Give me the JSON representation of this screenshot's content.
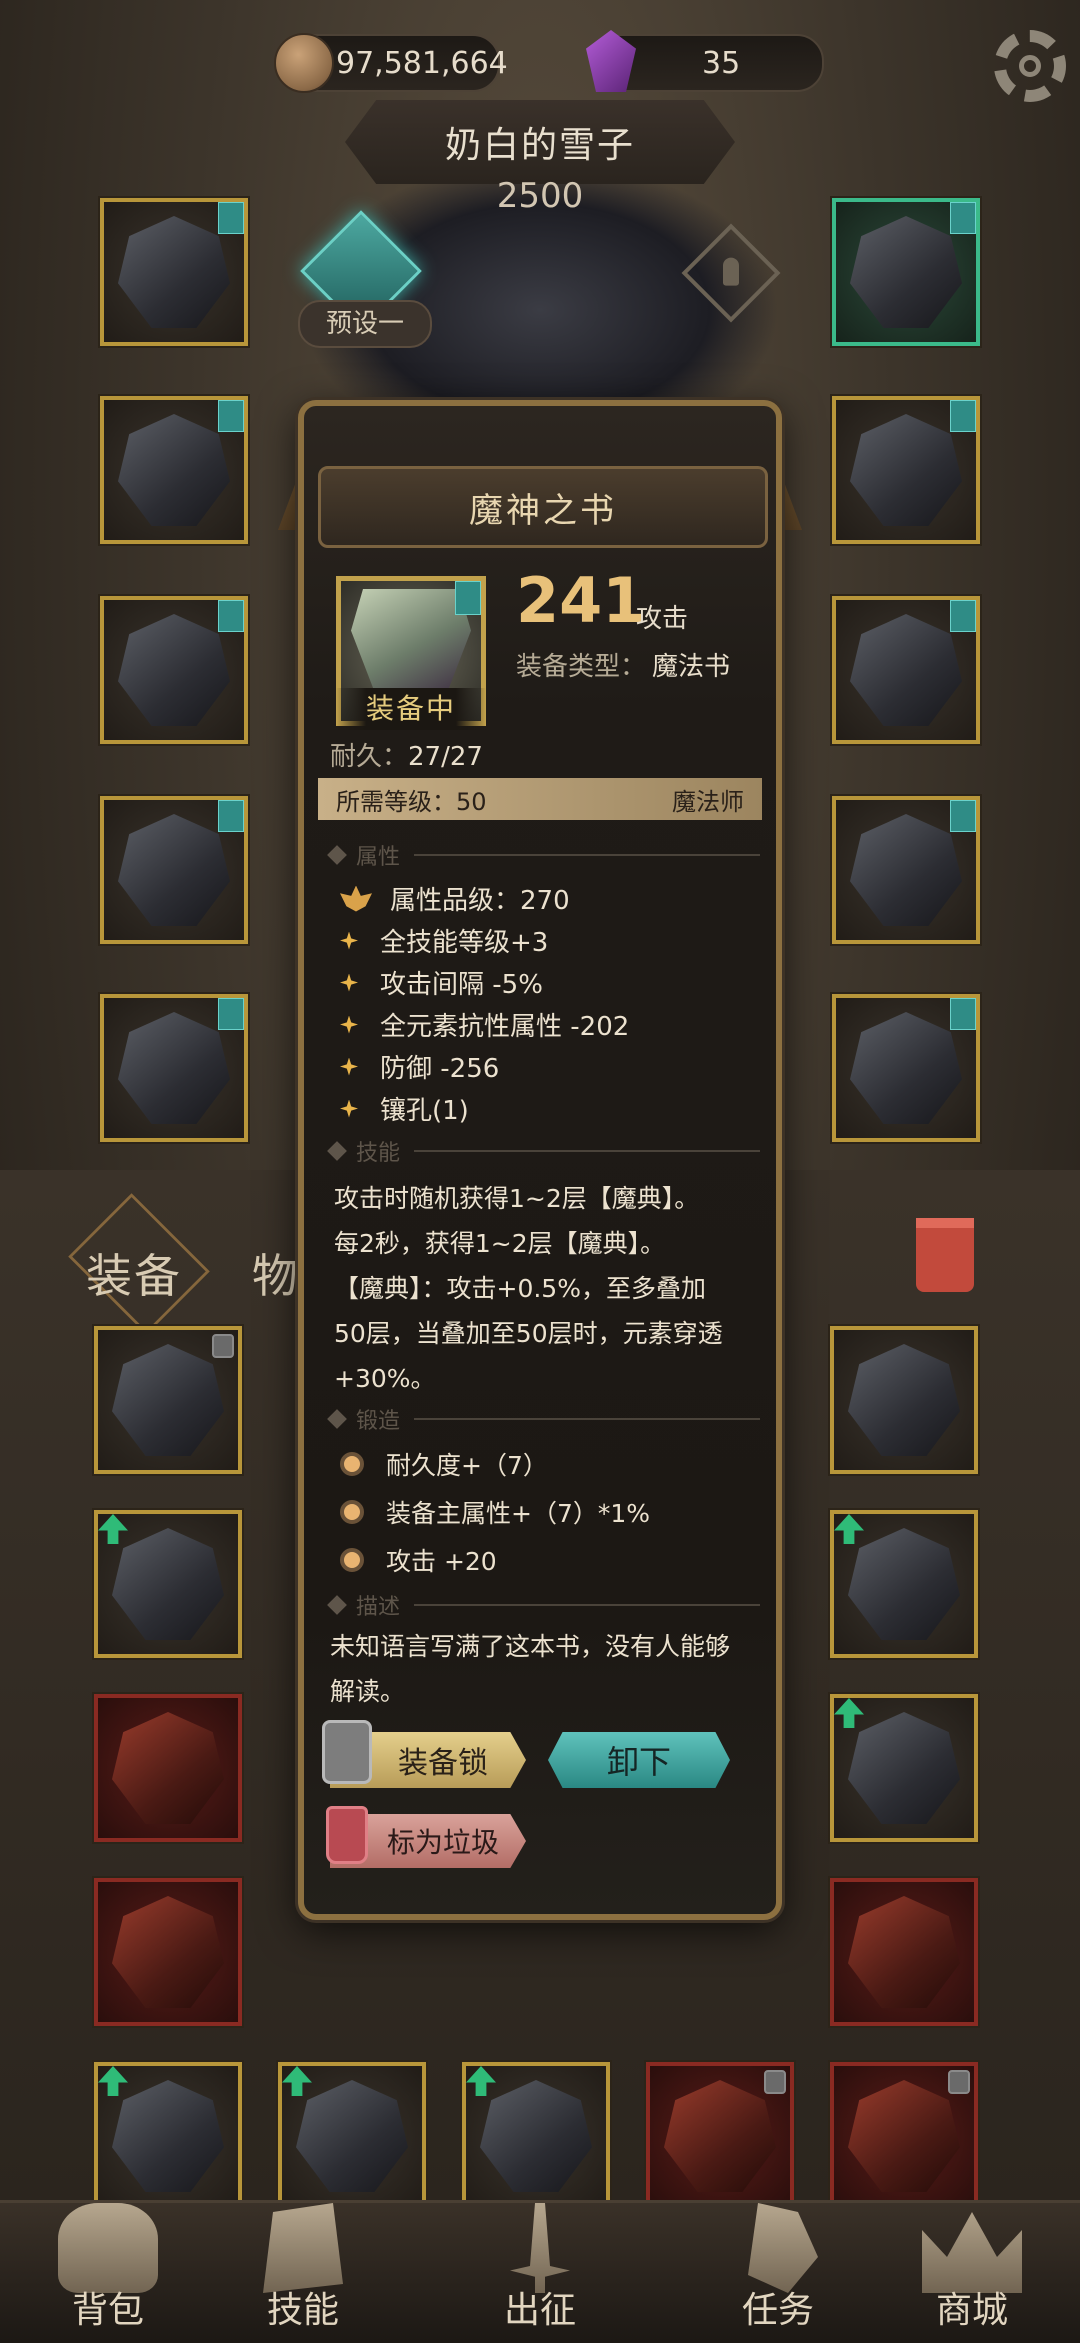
{
  "topbar": {
    "coins": "97,581,664",
    "gems": "35"
  },
  "character": {
    "name": "奶白的雪子",
    "power": "2500",
    "preset_label": "预设一"
  },
  "tabs": {
    "equipment": "装备",
    "items": "物品"
  },
  "popup": {
    "title": "魔神之书",
    "equipped_label": "装备中",
    "attack_value": "241",
    "attack_label": "攻击",
    "type_label": "装备类型：",
    "type_value": "魔法书",
    "durability_label": "耐久：",
    "durability_value": "27/27",
    "req_level": "所需等级：50",
    "req_class": "魔法师",
    "sections": {
      "attributes": "属性",
      "skills": "技能",
      "forge": "锻造",
      "description": "描述"
    },
    "attr_grade": "属性品级：270",
    "attributes": [
      "全技能等级+3",
      "攻击间隔 -5%",
      "全元素抗性属性 -202",
      "防御 -256",
      "镶孔(1)"
    ],
    "skill_lines": [
      "攻击时随机获得1~2层【魔典】。",
      "每2秒，获得1~2层【魔典】。",
      "【魔典】：攻击+0.5%，至多叠加",
      "50层，当叠加至50层时，元素穿透",
      "+30%。"
    ],
    "forge": [
      "耐久度+（7）",
      "装备主属性+（7）*1%",
      "攻击 +20"
    ],
    "description_lines": [
      "未知语言写满了这本书，没有人能够",
      "解读。"
    ],
    "buttons": {
      "lock": "装备锁",
      "unequip": "卸下",
      "trash": "标为垃圾"
    }
  },
  "nav": [
    "背包",
    "技能",
    "出征",
    "任务",
    "商城"
  ],
  "icons": [
    "coin-icon",
    "gem-icon",
    "gear-icon",
    "preset-icon",
    "trash-icon",
    "lock-icon",
    "star-icon",
    "lotus-icon"
  ],
  "colors": {
    "accent_gold": "#e8c17a",
    "teal": "#2f8c86",
    "frame_gold": "#b8963a"
  }
}
